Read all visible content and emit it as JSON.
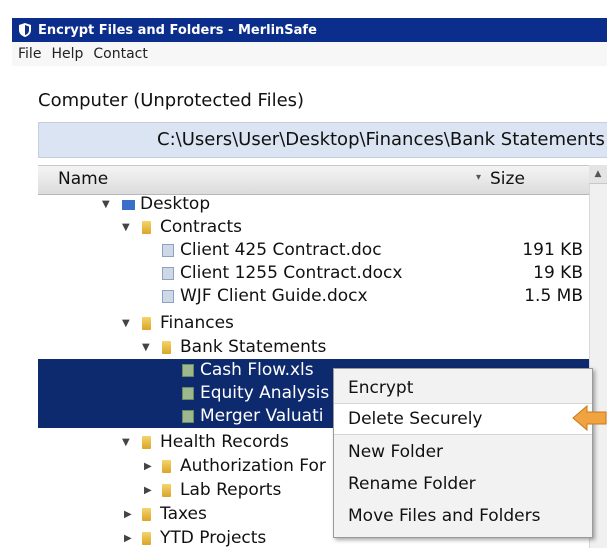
{
  "window": {
    "title": "Encrypt Files and Folders - MerlinSafe",
    "app_icon": "shield-icon"
  },
  "menubar": {
    "items": [
      "File",
      "Help",
      "Contact"
    ]
  },
  "panel": {
    "title": "Computer (Unprotected Files)",
    "path": "C:\\Users\\User\\Desktop\\Finances\\Bank Statements"
  },
  "columns": {
    "name": "Name",
    "size": "Size"
  },
  "tree": [
    {
      "label": "Desktop",
      "size": "",
      "icon": "desktop-icon",
      "expanded": true,
      "selected": false
    },
    {
      "label": "Contracts",
      "size": "",
      "icon": "folder-icon",
      "expanded": true,
      "selected": false
    },
    {
      "label": "Client 425 Contract.doc",
      "size": "191 KB",
      "icon": "document-icon",
      "selected": false
    },
    {
      "label": "Client 1255 Contract.docx",
      "size": "19 KB",
      "icon": "document-icon",
      "selected": false
    },
    {
      "label": "WJF Client Guide.docx",
      "size": "1.5 MB",
      "icon": "document-icon",
      "selected": false
    },
    {
      "label": "Finances",
      "size": "",
      "icon": "folder-icon",
      "expanded": true,
      "selected": false
    },
    {
      "label": "Bank Statements",
      "size": "",
      "icon": "folder-icon",
      "expanded": true,
      "selected": false
    },
    {
      "label": "Cash Flow.xls",
      "size": "",
      "icon": "spreadsheet-icon",
      "selected": true
    },
    {
      "label": "Equity Analysis",
      "size": "",
      "icon": "spreadsheet-icon",
      "selected": true
    },
    {
      "label": "Merger Valuati",
      "size": "",
      "icon": "spreadsheet-icon",
      "selected": true
    },
    {
      "label": "Health Records",
      "size": "",
      "icon": "folder-icon",
      "expanded": true,
      "selected": false
    },
    {
      "label": "Authorization For",
      "size": "",
      "icon": "folder-icon",
      "expanded": false,
      "selected": false
    },
    {
      "label": "Lab Reports",
      "size": "",
      "icon": "folder-icon",
      "expanded": false,
      "selected": false
    },
    {
      "label": "Taxes",
      "size": "",
      "icon": "folder-icon",
      "expanded": false,
      "selected": false
    },
    {
      "label": "YTD Projects",
      "size": "",
      "icon": "folder-icon",
      "expanded": false,
      "selected": false
    }
  ],
  "context_menu": {
    "items": [
      "Encrypt",
      "Delete Securely",
      "New Folder",
      "Rename Folder",
      "Move Files and Folders"
    ],
    "highlighted": "Delete Securely"
  },
  "colors": {
    "titlebar": "#0b2e8c",
    "selection": "#0e2a6e",
    "path_bar": "#dbe4f2",
    "pointer": "#f0a340"
  }
}
